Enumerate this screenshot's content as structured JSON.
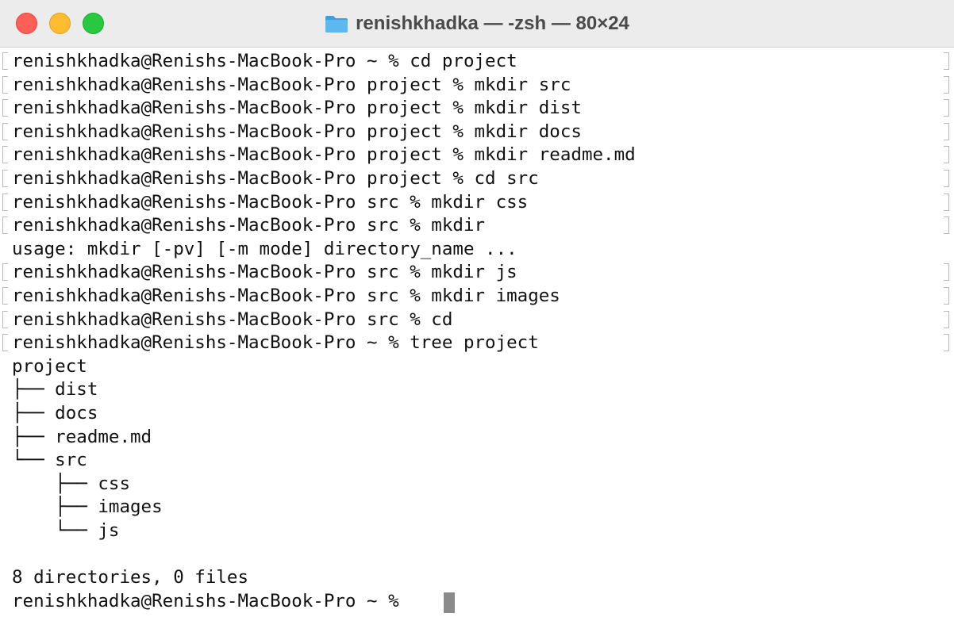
{
  "window": {
    "title": "renishkhadka — -zsh — 80×24",
    "title_icon": "folder-icon",
    "controls": [
      "close",
      "minimize",
      "zoom"
    ],
    "colors": {
      "close": "#ff5f57",
      "minimize": "#febc2e",
      "zoom": "#28c840",
      "folder": "#4aaee8"
    }
  },
  "terminal": {
    "lines": [
      {
        "text": "renishkhadka@Renishs-MacBook-Pro ~ % cd project",
        "marked": true
      },
      {
        "text": "renishkhadka@Renishs-MacBook-Pro project % mkdir src",
        "marked": true
      },
      {
        "text": "renishkhadka@Renishs-MacBook-Pro project % mkdir dist",
        "marked": true
      },
      {
        "text": "renishkhadka@Renishs-MacBook-Pro project % mkdir docs",
        "marked": true
      },
      {
        "text": "renishkhadka@Renishs-MacBook-Pro project % mkdir readme.md",
        "marked": true
      },
      {
        "text": "renishkhadka@Renishs-MacBook-Pro project % cd src",
        "marked": true
      },
      {
        "text": "renishkhadka@Renishs-MacBook-Pro src % mkdir css",
        "marked": true
      },
      {
        "text": "renishkhadka@Renishs-MacBook-Pro src % mkdir",
        "marked": true
      },
      {
        "text": "usage: mkdir [-pv] [-m mode] directory_name ...",
        "marked": false
      },
      {
        "text": "renishkhadka@Renishs-MacBook-Pro src % mkdir js",
        "marked": true
      },
      {
        "text": "renishkhadka@Renishs-MacBook-Pro src % mkdir images",
        "marked": true
      },
      {
        "text": "renishkhadka@Renishs-MacBook-Pro src % cd",
        "marked": true
      },
      {
        "text": "renishkhadka@Renishs-MacBook-Pro ~ % tree project",
        "marked": true
      },
      {
        "text": "project",
        "marked": false
      },
      {
        "text": "├── dist",
        "marked": false
      },
      {
        "text": "├── docs",
        "marked": false
      },
      {
        "text": "├── readme.md",
        "marked": false
      },
      {
        "text": "└── src",
        "marked": false
      },
      {
        "text": "    ├── css",
        "marked": false
      },
      {
        "text": "    ├── images",
        "marked": false
      },
      {
        "text": "    └── js",
        "marked": false
      },
      {
        "text": "",
        "marked": false
      },
      {
        "text": "8 directories, 0 files",
        "marked": false
      },
      {
        "text": "renishkhadka@Renishs-MacBook-Pro ~ % ",
        "marked": false,
        "cursor": true
      }
    ]
  }
}
